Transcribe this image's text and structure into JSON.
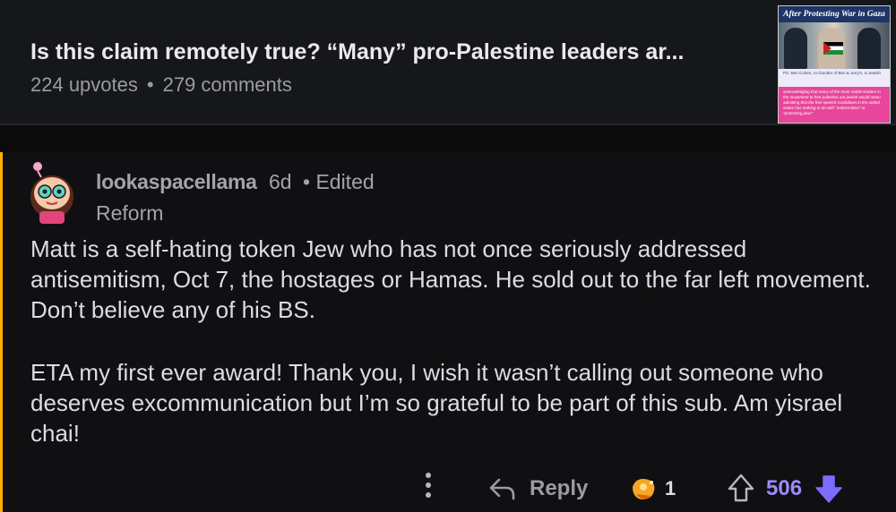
{
  "post": {
    "title": "Is this claim remotely true? “Many” pro-Palestine leaders ar...",
    "upvotes": "224 upvotes",
    "separator": "•",
    "comments": "279 comments",
    "thumbnail": {
      "headline": "After Protesting War in Gaza",
      "caption": "Pic: Ben Cohen, co-founder of Ben & Jerry's, is Jewish",
      "text": "acknowledging that many of the most visible leaders in the movement to free palestine are jewish would mean admitting that the free speech crackdown in the united states has nothing to do with \"antisemitism\" or \"protecting jews\""
    }
  },
  "comment": {
    "username": "lookaspacellama",
    "time": "6d",
    "edited": "• Edited",
    "flair": "Reform",
    "paragraphs": [
      "Matt is a self-hating token Jew who has not once seriously addressed antisemitism, Oct 7, the hostages or Hamas. He sold out to the far left movement. Don’t believe any of his BS.",
      "ETA my first ever award! Thank you, I wish it wasn’t calling out someone who deserves excommunication but I’m so grateful to be part of this sub. Am yisrael chai!"
    ]
  },
  "actions": {
    "reply": "Reply",
    "award_count": "1",
    "score": "506"
  },
  "colors": {
    "background": "#0b0b0c",
    "thread_line": "#ffb100",
    "upvoted": "#9b8cff",
    "downvote": "#7c6bff"
  },
  "icons": [
    "more-options-icon",
    "reply-icon",
    "award-icon",
    "upvote-icon",
    "downvote-icon",
    "avatar"
  ]
}
